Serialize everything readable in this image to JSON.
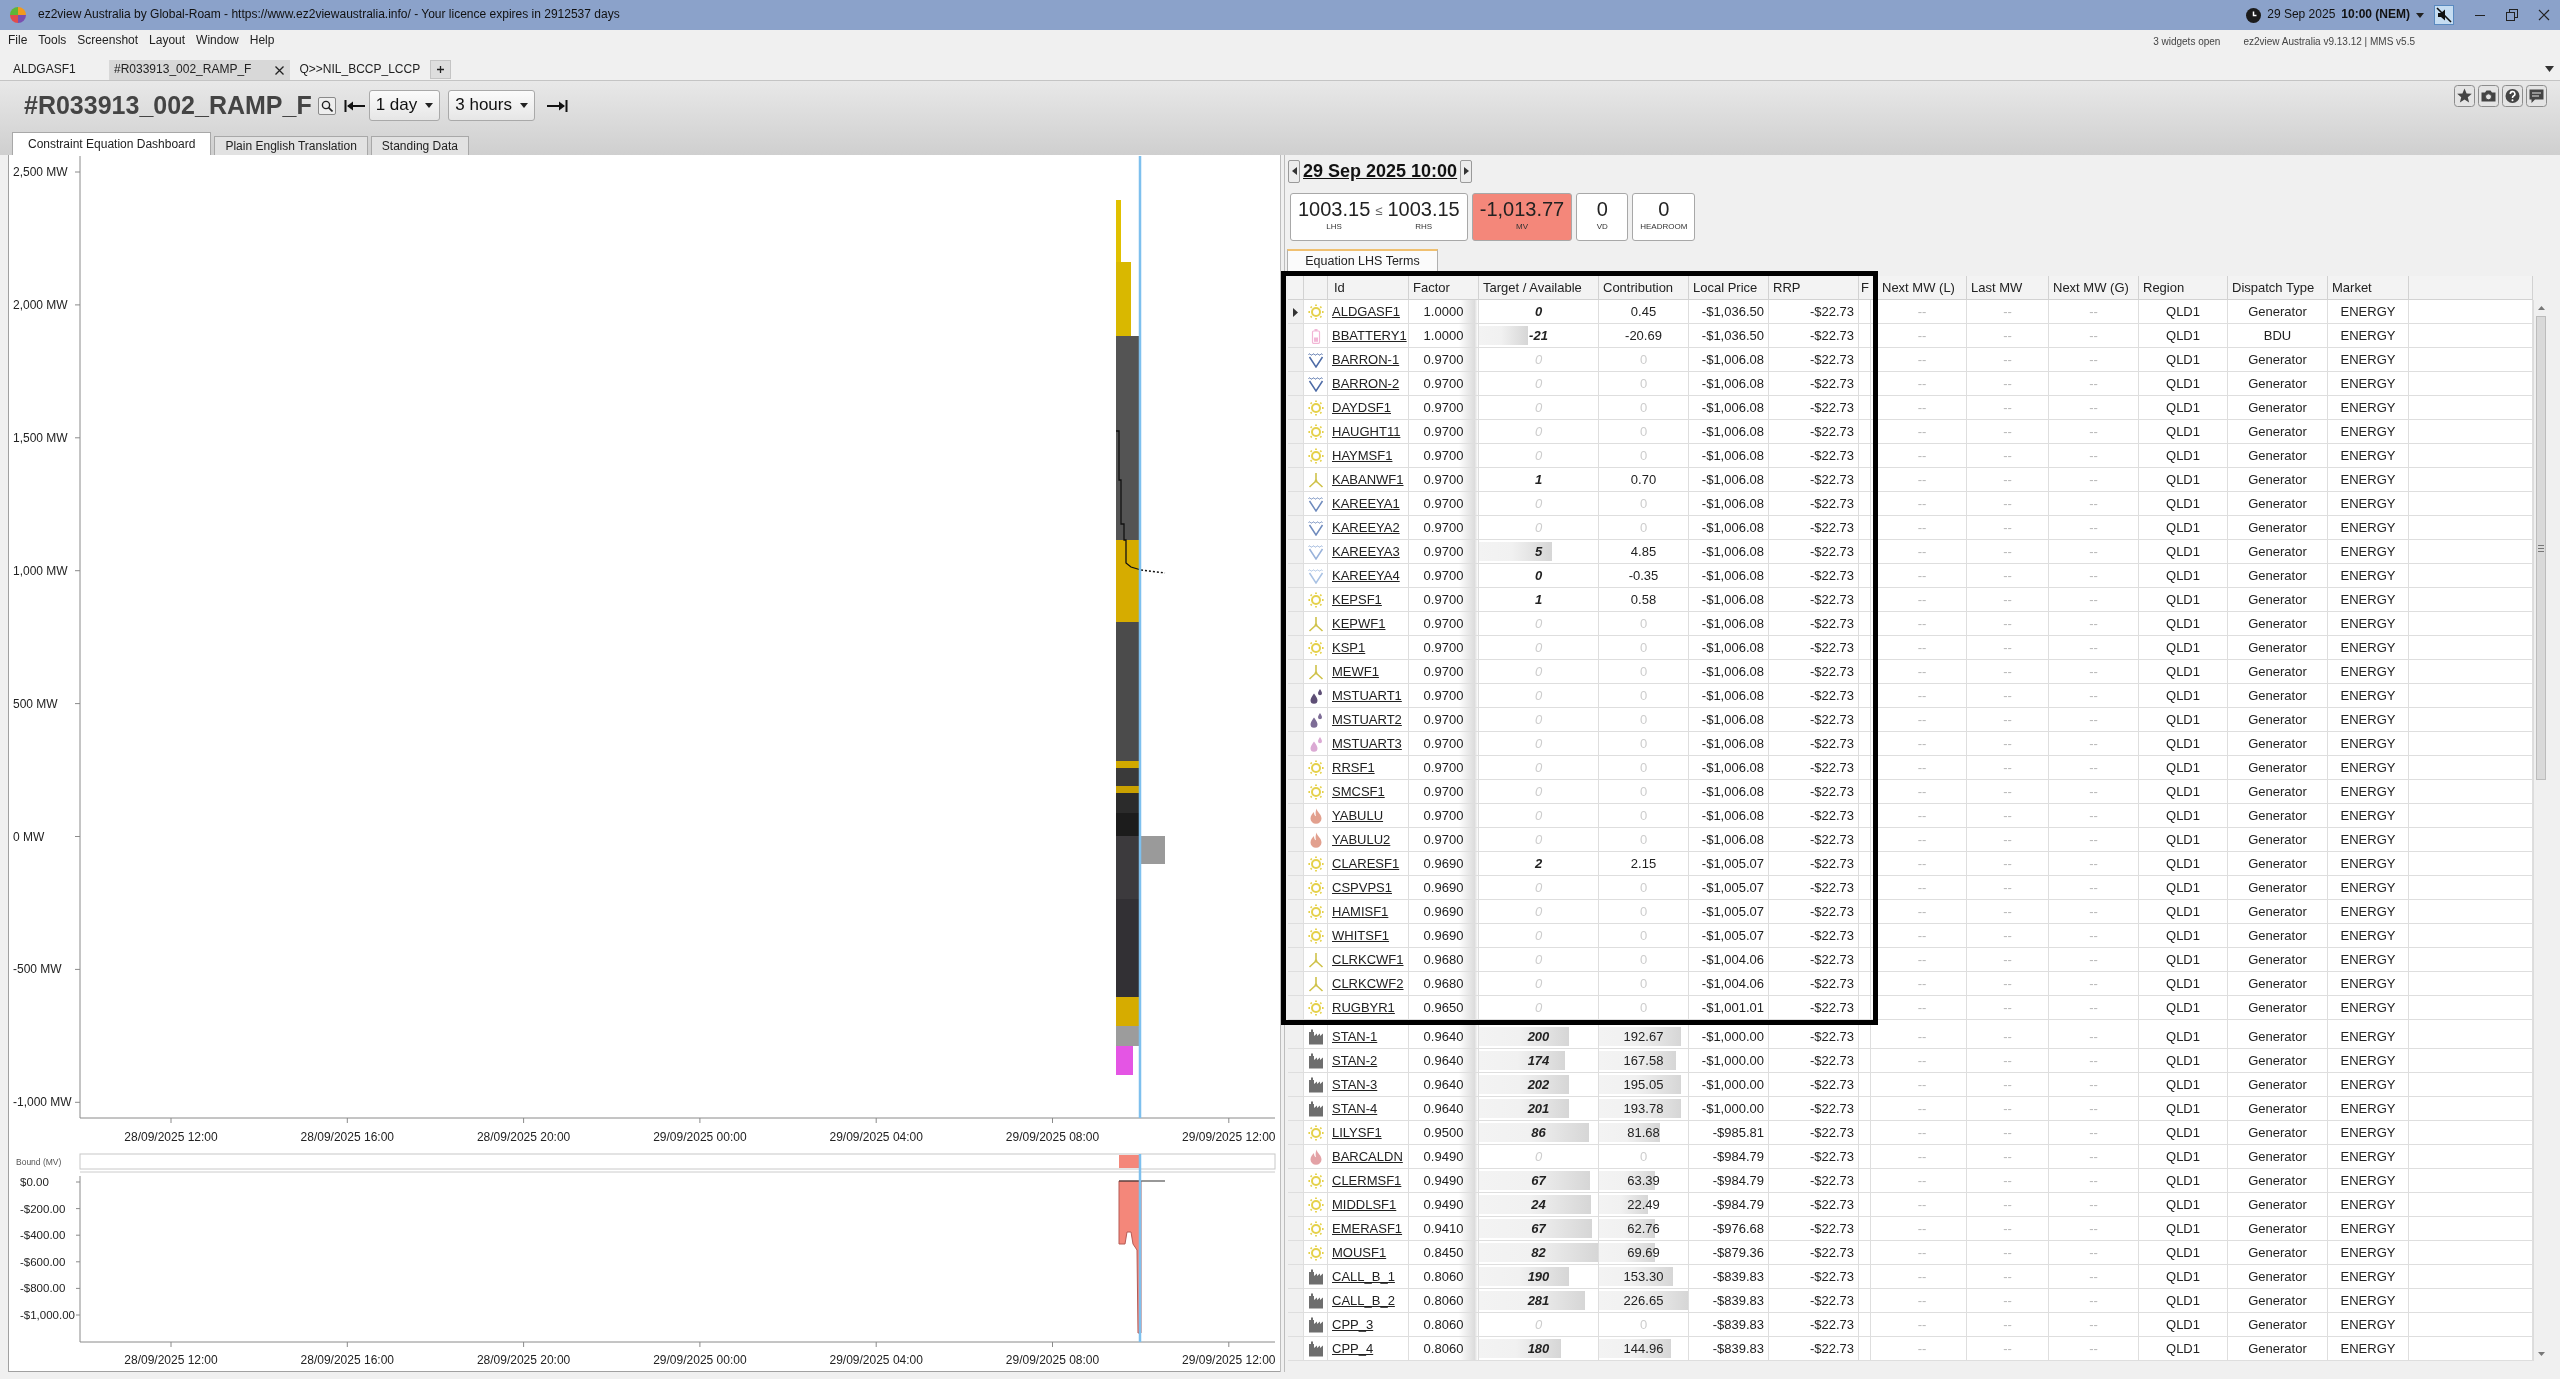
{
  "window": {
    "title": "ez2view Australia by Global-Roam - https://www.ez2viewaustralia.info/ - Your licence expires in 2912537 days",
    "date": "29 Sep 2025",
    "time": "10:00 (NEM)"
  },
  "menu": [
    "File",
    "Tools",
    "Screenshot",
    "Layout",
    "Window",
    "Help"
  ],
  "status": {
    "widgets": "3 widgets open",
    "version": "ez2view Australia v9.13.12 | MMS v5.5"
  },
  "widget_tabs": [
    {
      "label": "ALDGASF1",
      "selected": false
    },
    {
      "label": "#R033913_002_RAMP_F",
      "selected": true
    },
    {
      "label": "Q>>NIL_BCCP_LCCP",
      "selected": false
    }
  ],
  "widget": {
    "title": "#R033913_002_RAMP_F",
    "range": "1 day",
    "interval": "3 hours"
  },
  "view_tabs": [
    {
      "label": "Constraint Equation Dashboard",
      "selected": true
    },
    {
      "label": "Plain English Translation",
      "selected": false
    },
    {
      "label": "Standing Data",
      "selected": false
    }
  ],
  "chart": {
    "y_labels": [
      "2,500 MW",
      "2,000 MW",
      "1,500 MW",
      "1,000 MW",
      "500 MW",
      "0 MW",
      "-500 MW",
      "-1,000 MW"
    ],
    "x_labels": [
      "28/09/2025 12:00",
      "28/09/2025 16:00",
      "28/09/2025 20:00",
      "29/09/2025 00:00",
      "29/09/2025 04:00",
      "29/09/2025 08:00",
      "29/09/2025 12:00"
    ]
  },
  "bound_chart": {
    "label": "Bound (MV)",
    "y_labels": [
      "$0.00",
      "-$200.00",
      "-$400.00",
      "-$600.00",
      "-$800.00",
      "-$1,000.00"
    ],
    "x_labels": [
      "28/09/2025 12:00",
      "28/09/2025 16:00",
      "28/09/2025 20:00",
      "29/09/2025 00:00",
      "29/09/2025 04:00",
      "29/09/2025 08:00",
      "29/09/2025 12:00"
    ]
  },
  "interval_nav": {
    "datetime": "29 Sep 2025 10:00"
  },
  "summary": {
    "lhs": {
      "value": "1003.15",
      "caption": "LHS"
    },
    "operator": "≤",
    "rhs": {
      "value": "1003.15",
      "caption": "RHS"
    },
    "boxes": [
      {
        "value": "-1,013.77",
        "caption": "MV",
        "alert": true
      },
      {
        "value": "0",
        "caption": "VD",
        "alert": false
      },
      {
        "value": "0",
        "caption": "HEADROOM",
        "alert": false
      }
    ]
  },
  "terms_tab": {
    "label": "Equation LHS Terms",
    "selected": true
  },
  "table": {
    "columns": [
      "Id",
      "Factor",
      "Target / Available",
      "Contribution",
      "Local Price",
      "RRP",
      "F",
      "Next MW (L)",
      "Last MW",
      "Next MW (G)",
      "Region",
      "Dispatch Type",
      "Market"
    ],
    "rows": [
      {
        "selected": true,
        "kind": "sun",
        "color": "#e5d14a",
        "id": "ALDGASF1",
        "factor": "1.0000",
        "target": {
          "text": "0"
        },
        "contribution": {
          "text": "0.45"
        },
        "dimmed": false,
        "local_price": "-$1,036.50",
        "rrp": "-$22.73",
        "next_mw_l": "--",
        "last_mw": "--",
        "next_mw_g": "--",
        "region": "QLD1",
        "dispatch_type": "Generator",
        "market": "ENERGY"
      },
      {
        "selected": false,
        "kind": "battery",
        "color": "#f2b6d6",
        "id": "BBATTERY1",
        "factor": "1.0000",
        "target": {
          "text": "-21",
          "level": 0.41
        },
        "contribution": {
          "text": "-20.69"
        },
        "dimmed": false,
        "local_price": "-$1,036.50",
        "rrp": "-$22.73",
        "next_mw_l": "--",
        "last_mw": "--",
        "next_mw_g": "--",
        "region": "QLD1",
        "dispatch_type": "BDU",
        "market": "ENERGY"
      },
      {
        "selected": false,
        "kind": "water",
        "color": "#4d6ba6",
        "id": "BARRON-1",
        "factor": "0.9700",
        "target": {
          "text": "0"
        },
        "contribution": {
          "text": "0"
        },
        "dimmed": true,
        "local_price": "-$1,006.08",
        "rrp": "-$22.73",
        "next_mw_l": "--",
        "last_mw": "--",
        "next_mw_g": "--",
        "region": "QLD1",
        "dispatch_type": "Generator",
        "market": "ENERGY"
      },
      {
        "selected": false,
        "kind": "water",
        "color": "#4d6ba6",
        "id": "BARRON-2",
        "factor": "0.9700",
        "target": {
          "text": "0"
        },
        "contribution": {
          "text": "0"
        },
        "dimmed": true,
        "local_price": "-$1,006.08",
        "rrp": "-$22.73",
        "next_mw_l": "--",
        "last_mw": "--",
        "next_mw_g": "--",
        "region": "QLD1",
        "dispatch_type": "Generator",
        "market": "ENERGY"
      },
      {
        "selected": false,
        "kind": "sun",
        "color": "#e5d14a",
        "id": "DAYDSF1",
        "factor": "0.9700",
        "target": {
          "text": "0"
        },
        "contribution": {
          "text": "0"
        },
        "dimmed": true,
        "local_price": "-$1,006.08",
        "rrp": "-$22.73",
        "next_mw_l": "--",
        "last_mw": "--",
        "next_mw_g": "--",
        "region": "QLD1",
        "dispatch_type": "Generator",
        "market": "ENERGY"
      },
      {
        "selected": false,
        "kind": "sun",
        "color": "#e5d14a",
        "id": "HAUGHT11",
        "factor": "0.9700",
        "target": {
          "text": "0"
        },
        "contribution": {
          "text": "0"
        },
        "dimmed": true,
        "local_price": "-$1,006.08",
        "rrp": "-$22.73",
        "next_mw_l": "--",
        "last_mw": "--",
        "next_mw_g": "--",
        "region": "QLD1",
        "dispatch_type": "Generator",
        "market": "ENERGY"
      },
      {
        "selected": false,
        "kind": "sun",
        "color": "#e5d14a",
        "id": "HAYMSF1",
        "factor": "0.9700",
        "target": {
          "text": "0"
        },
        "contribution": {
          "text": "0"
        },
        "dimmed": true,
        "local_price": "-$1,006.08",
        "rrp": "-$22.73",
        "next_mw_l": "--",
        "last_mw": "--",
        "next_mw_g": "--",
        "region": "QLD1",
        "dispatch_type": "Generator",
        "market": "ENERGY"
      },
      {
        "selected": false,
        "kind": "turbine",
        "color": "#cfc24a",
        "id": "KABANWF1",
        "factor": "0.9700",
        "target": {
          "text": "1"
        },
        "contribution": {
          "text": "0.70"
        },
        "dimmed": false,
        "local_price": "-$1,006.08",
        "rrp": "-$22.73",
        "next_mw_l": "--",
        "last_mw": "--",
        "next_mw_g": "--",
        "region": "QLD1",
        "dispatch_type": "Generator",
        "market": "ENERGY"
      },
      {
        "selected": false,
        "kind": "water",
        "color": "#6f8bbd",
        "id": "KAREEYA1",
        "factor": "0.9700",
        "target": {
          "text": "0"
        },
        "contribution": {
          "text": "0"
        },
        "dimmed": true,
        "local_price": "-$1,006.08",
        "rrp": "-$22.73",
        "next_mw_l": "--",
        "last_mw": "--",
        "next_mw_g": "--",
        "region": "QLD1",
        "dispatch_type": "Generator",
        "market": "ENERGY"
      },
      {
        "selected": false,
        "kind": "water",
        "color": "#6f8bbd",
        "id": "KAREEYA2",
        "factor": "0.9700",
        "target": {
          "text": "0"
        },
        "contribution": {
          "text": "0"
        },
        "dimmed": true,
        "local_price": "-$1,006.08",
        "rrp": "-$22.73",
        "next_mw_l": "--",
        "last_mw": "--",
        "next_mw_g": "--",
        "region": "QLD1",
        "dispatch_type": "Generator",
        "market": "ENERGY"
      },
      {
        "selected": false,
        "kind": "water",
        "color": "#98b2da",
        "id": "KAREEYA3",
        "factor": "0.9700",
        "target": {
          "text": "5",
          "level": 0.61
        },
        "contribution": {
          "text": "4.85"
        },
        "dimmed": false,
        "local_price": "-$1,006.08",
        "rrp": "-$22.73",
        "next_mw_l": "--",
        "last_mw": "--",
        "next_mw_g": "--",
        "region": "QLD1",
        "dispatch_type": "Generator",
        "market": "ENERGY"
      },
      {
        "selected": false,
        "kind": "water",
        "color": "#a9c2e4",
        "id": "KAREEYA4",
        "factor": "0.9700",
        "target": {
          "text": "0"
        },
        "contribution": {
          "text": "-0.35"
        },
        "dimmed": false,
        "local_price": "-$1,006.08",
        "rrp": "-$22.73",
        "next_mw_l": "--",
        "last_mw": "--",
        "next_mw_g": "--",
        "region": "QLD1",
        "dispatch_type": "Generator",
        "market": "ENERGY"
      },
      {
        "selected": false,
        "kind": "sun",
        "color": "#e5d14a",
        "id": "KEPSF1",
        "factor": "0.9700",
        "target": {
          "text": "1"
        },
        "contribution": {
          "text": "0.58"
        },
        "dimmed": false,
        "local_price": "-$1,006.08",
        "rrp": "-$22.73",
        "next_mw_l": "--",
        "last_mw": "--",
        "next_mw_g": "--",
        "region": "QLD1",
        "dispatch_type": "Generator",
        "market": "ENERGY"
      },
      {
        "selected": false,
        "kind": "turbine",
        "color": "#cfc24a",
        "id": "KEPWF1",
        "factor": "0.9700",
        "target": {
          "text": "0"
        },
        "contribution": {
          "text": "0"
        },
        "dimmed": true,
        "local_price": "-$1,006.08",
        "rrp": "-$22.73",
        "next_mw_l": "--",
        "last_mw": "--",
        "next_mw_g": "--",
        "region": "QLD1",
        "dispatch_type": "Generator",
        "market": "ENERGY"
      },
      {
        "selected": false,
        "kind": "sun",
        "color": "#e5d14a",
        "id": "KSP1",
        "factor": "0.9700",
        "target": {
          "text": "0"
        },
        "contribution": {
          "text": "0"
        },
        "dimmed": true,
        "local_price": "-$1,006.08",
        "rrp": "-$22.73",
        "next_mw_l": "--",
        "last_mw": "--",
        "next_mw_g": "--",
        "region": "QLD1",
        "dispatch_type": "Generator",
        "market": "ENERGY"
      },
      {
        "selected": false,
        "kind": "turbine",
        "color": "#cfc24a",
        "id": "MEWF1",
        "factor": "0.9700",
        "target": {
          "text": "0"
        },
        "contribution": {
          "text": "0"
        },
        "dimmed": true,
        "local_price": "-$1,006.08",
        "rrp": "-$22.73",
        "next_mw_l": "--",
        "last_mw": "--",
        "next_mw_g": "--",
        "region": "QLD1",
        "dispatch_type": "Generator",
        "market": "ENERGY"
      },
      {
        "selected": false,
        "kind": "drops",
        "color": "#5e4f76",
        "id": "MSTUART1",
        "factor": "0.9700",
        "target": {
          "text": "0"
        },
        "contribution": {
          "text": "0"
        },
        "dimmed": true,
        "local_price": "-$1,006.08",
        "rrp": "-$22.73",
        "next_mw_l": "--",
        "last_mw": "--",
        "next_mw_g": "--",
        "region": "QLD1",
        "dispatch_type": "Generator",
        "market": "ENERGY"
      },
      {
        "selected": false,
        "kind": "drops",
        "color": "#7d6c96",
        "id": "MSTUART2",
        "factor": "0.9700",
        "target": {
          "text": "0"
        },
        "contribution": {
          "text": "0"
        },
        "dimmed": true,
        "local_price": "-$1,006.08",
        "rrp": "-$22.73",
        "next_mw_l": "--",
        "last_mw": "--",
        "next_mw_g": "--",
        "region": "QLD1",
        "dispatch_type": "Generator",
        "market": "ENERGY"
      },
      {
        "selected": false,
        "kind": "drops",
        "color": "#dbaad4",
        "id": "MSTUART3",
        "factor": "0.9700",
        "target": {
          "text": "0"
        },
        "contribution": {
          "text": "0"
        },
        "dimmed": true,
        "local_price": "-$1,006.08",
        "rrp": "-$22.73",
        "next_mw_l": "--",
        "last_mw": "--",
        "next_mw_g": "--",
        "region": "QLD1",
        "dispatch_type": "Generator",
        "market": "ENERGY"
      },
      {
        "selected": false,
        "kind": "sun",
        "color": "#e5d14a",
        "id": "RRSF1",
        "factor": "0.9700",
        "target": {
          "text": "0"
        },
        "contribution": {
          "text": "0"
        },
        "dimmed": true,
        "local_price": "-$1,006.08",
        "rrp": "-$22.73",
        "next_mw_l": "--",
        "last_mw": "--",
        "next_mw_g": "--",
        "region": "QLD1",
        "dispatch_type": "Generator",
        "market": "ENERGY"
      },
      {
        "selected": false,
        "kind": "sun",
        "color": "#e5d14a",
        "id": "SMCSF1",
        "factor": "0.9700",
        "target": {
          "text": "0"
        },
        "contribution": {
          "text": "0"
        },
        "dimmed": true,
        "local_price": "-$1,006.08",
        "rrp": "-$22.73",
        "next_mw_l": "--",
        "last_mw": "--",
        "next_mw_g": "--",
        "region": "QLD1",
        "dispatch_type": "Generator",
        "market": "ENERGY"
      },
      {
        "selected": false,
        "kind": "flame",
        "color": "#e2a08e",
        "id": "YABULU",
        "factor": "0.9700",
        "target": {
          "text": "0"
        },
        "contribution": {
          "text": "0"
        },
        "dimmed": true,
        "local_price": "-$1,006.08",
        "rrp": "-$22.73",
        "next_mw_l": "--",
        "last_mw": "--",
        "next_mw_g": "--",
        "region": "QLD1",
        "dispatch_type": "Generator",
        "market": "ENERGY"
      },
      {
        "selected": false,
        "kind": "flame",
        "color": "#e2a08e",
        "id": "YABULU2",
        "factor": "0.9700",
        "target": {
          "text": "0"
        },
        "contribution": {
          "text": "0"
        },
        "dimmed": true,
        "local_price": "-$1,006.08",
        "rrp": "-$22.73",
        "next_mw_l": "--",
        "last_mw": "--",
        "next_mw_g": "--",
        "region": "QLD1",
        "dispatch_type": "Generator",
        "market": "ENERGY"
      },
      {
        "selected": false,
        "kind": "sun",
        "color": "#e5d14a",
        "id": "CLARESF1",
        "factor": "0.9690",
        "target": {
          "text": "2"
        },
        "contribution": {
          "text": "2.15"
        },
        "dimmed": false,
        "local_price": "-$1,005.07",
        "rrp": "-$22.73",
        "next_mw_l": "--",
        "last_mw": "--",
        "next_mw_g": "--",
        "region": "QLD1",
        "dispatch_type": "Generator",
        "market": "ENERGY"
      },
      {
        "selected": false,
        "kind": "sun",
        "color": "#e5d14a",
        "id": "CSPVPS1",
        "factor": "0.9690",
        "target": {
          "text": "0"
        },
        "contribution": {
          "text": "0"
        },
        "dimmed": true,
        "local_price": "-$1,005.07",
        "rrp": "-$22.73",
        "next_mw_l": "--",
        "last_mw": "--",
        "next_mw_g": "--",
        "region": "QLD1",
        "dispatch_type": "Generator",
        "market": "ENERGY"
      },
      {
        "selected": false,
        "kind": "sun",
        "color": "#e5d14a",
        "id": "HAMISF1",
        "factor": "0.9690",
        "target": {
          "text": "0"
        },
        "contribution": {
          "text": "0"
        },
        "dimmed": true,
        "local_price": "-$1,005.07",
        "rrp": "-$22.73",
        "next_mw_l": "--",
        "last_mw": "--",
        "next_mw_g": "--",
        "region": "QLD1",
        "dispatch_type": "Generator",
        "market": "ENERGY"
      },
      {
        "selected": false,
        "kind": "sun",
        "color": "#e5d14a",
        "id": "WHITSF1",
        "factor": "0.9690",
        "target": {
          "text": "0"
        },
        "contribution": {
          "text": "0"
        },
        "dimmed": true,
        "local_price": "-$1,005.07",
        "rrp": "-$22.73",
        "next_mw_l": "--",
        "last_mw": "--",
        "next_mw_g": "--",
        "region": "QLD1",
        "dispatch_type": "Generator",
        "market": "ENERGY"
      },
      {
        "selected": false,
        "kind": "turbine",
        "color": "#cfc24a",
        "id": "CLRKCWF1",
        "factor": "0.9680",
        "target": {
          "text": "0"
        },
        "contribution": {
          "text": "0"
        },
        "dimmed": true,
        "local_price": "-$1,004.06",
        "rrp": "-$22.73",
        "next_mw_l": "--",
        "last_mw": "--",
        "next_mw_g": "--",
        "region": "QLD1",
        "dispatch_type": "Generator",
        "market": "ENERGY"
      },
      {
        "selected": false,
        "kind": "turbine",
        "color": "#cfc24a",
        "id": "CLRKCWF2",
        "factor": "0.9680",
        "target": {
          "text": "0"
        },
        "contribution": {
          "text": "0"
        },
        "dimmed": true,
        "local_price": "-$1,004.06",
        "rrp": "-$22.73",
        "next_mw_l": "--",
        "last_mw": "--",
        "next_mw_g": "--",
        "region": "QLD1",
        "dispatch_type": "Generator",
        "market": "ENERGY"
      },
      {
        "selected": false,
        "kind": "sun",
        "color": "#e5d14a",
        "id": "RUGBYR1",
        "factor": "0.9650",
        "target": {
          "text": "0"
        },
        "contribution": {
          "text": "0"
        },
        "dimmed": true,
        "local_price": "-$1,001.01",
        "rrp": "-$22.73",
        "next_mw_l": "--",
        "last_mw": "--",
        "next_mw_g": "--",
        "region": "QLD1",
        "dispatch_type": "Generator",
        "market": "ENERGY"
      },
      {
        "selected": false,
        "kind": "factory",
        "color": "#6e6e6e",
        "id": "STAN-1",
        "factor": "0.9640",
        "target": {
          "text": "200",
          "level": 0.755
        },
        "contribution": {
          "text": "192.67",
          "level": 0.92
        },
        "dimmed": false,
        "local_price": "-$1,000.00",
        "rrp": "-$22.73",
        "next_mw_l": "--",
        "last_mw": "--",
        "next_mw_g": "--",
        "region": "QLD1",
        "dispatch_type": "Generator",
        "market": "ENERGY"
      },
      {
        "selected": false,
        "kind": "factory",
        "color": "#6e6e6e",
        "id": "STAN-2",
        "factor": "0.9640",
        "target": {
          "text": "174",
          "level": 0.72
        },
        "contribution": {
          "text": "167.58",
          "level": 0.86
        },
        "dimmed": false,
        "local_price": "-$1,000.00",
        "rrp": "-$22.73",
        "next_mw_l": "--",
        "last_mw": "--",
        "next_mw_g": "--",
        "region": "QLD1",
        "dispatch_type": "Generator",
        "market": "ENERGY"
      },
      {
        "selected": false,
        "kind": "factory",
        "color": "#6e6e6e",
        "id": "STAN-3",
        "factor": "0.9640",
        "target": {
          "text": "202",
          "level": 0.755
        },
        "contribution": {
          "text": "195.05",
          "level": 0.92
        },
        "dimmed": false,
        "local_price": "-$1,000.00",
        "rrp": "-$22.73",
        "next_mw_l": "--",
        "last_mw": "--",
        "next_mw_g": "--",
        "region": "QLD1",
        "dispatch_type": "Generator",
        "market": "ENERGY"
      },
      {
        "selected": false,
        "kind": "factory",
        "color": "#6e6e6e",
        "id": "STAN-4",
        "factor": "0.9640",
        "target": {
          "text": "201",
          "level": 0.755
        },
        "contribution": {
          "text": "193.78",
          "level": 0.92
        },
        "dimmed": false,
        "local_price": "-$1,000.00",
        "rrp": "-$22.73",
        "next_mw_l": "--",
        "last_mw": "--",
        "next_mw_g": "--",
        "region": "QLD1",
        "dispatch_type": "Generator",
        "market": "ENERGY"
      },
      {
        "selected": false,
        "kind": "sun",
        "color": "#e5d14a",
        "id": "LILYSF1",
        "factor": "0.9500",
        "target": {
          "text": "86",
          "level": 0.925
        },
        "contribution": {
          "text": "81.68",
          "level": 0.68
        },
        "dimmed": false,
        "local_price": "-$985.81",
        "rrp": "-$22.73",
        "next_mw_l": "--",
        "last_mw": "--",
        "next_mw_g": "--",
        "region": "QLD1",
        "dispatch_type": "Generator",
        "market": "ENERGY"
      },
      {
        "selected": false,
        "kind": "flame",
        "color": "#e3a2a6",
        "id": "BARCALDN",
        "factor": "0.9490",
        "target": {
          "text": "0"
        },
        "contribution": {
          "text": "0"
        },
        "dimmed": true,
        "local_price": "-$984.79",
        "rrp": "-$22.73",
        "next_mw_l": "--",
        "last_mw": "--",
        "next_mw_g": "--",
        "region": "QLD1",
        "dispatch_type": "Generator",
        "market": "ENERGY"
      },
      {
        "selected": false,
        "kind": "sun",
        "color": "#e5d14a",
        "id": "CLERMSF1",
        "factor": "0.9490",
        "target": {
          "text": "67",
          "level": 0.935
        },
        "contribution": {
          "text": "63.39",
          "level": 0.63
        },
        "dimmed": false,
        "local_price": "-$984.79",
        "rrp": "-$22.73",
        "next_mw_l": "--",
        "last_mw": "--",
        "next_mw_g": "--",
        "region": "QLD1",
        "dispatch_type": "Generator",
        "market": "ENERGY"
      },
      {
        "selected": false,
        "kind": "sun",
        "color": "#e5d14a",
        "id": "MIDDLSF1",
        "factor": "0.9490",
        "target": {
          "text": "24",
          "level": 0.945
        },
        "contribution": {
          "text": "22.49",
          "level": 0.55
        },
        "dimmed": false,
        "local_price": "-$984.79",
        "rrp": "-$22.73",
        "next_mw_l": "--",
        "last_mw": "--",
        "next_mw_g": "--",
        "region": "QLD1",
        "dispatch_type": "Generator",
        "market": "ENERGY"
      },
      {
        "selected": false,
        "kind": "sun",
        "color": "#e5d14a",
        "id": "EMERASF1",
        "factor": "0.9410",
        "target": {
          "text": "67",
          "level": 0.95
        },
        "contribution": {
          "text": "62.76",
          "level": 0.63
        },
        "dimmed": false,
        "local_price": "-$976.68",
        "rrp": "-$22.73",
        "next_mw_l": "--",
        "last_mw": "--",
        "next_mw_g": "--",
        "region": "QLD1",
        "dispatch_type": "Generator",
        "market": "ENERGY"
      },
      {
        "selected": false,
        "kind": "sun",
        "color": "#e5d14a",
        "id": "MOUSF1",
        "factor": "0.8450",
        "target": {
          "text": "82",
          "level": 1
        },
        "contribution": {
          "text": "69.69",
          "level": 0.63
        },
        "dimmed": false,
        "local_price": "-$879.36",
        "rrp": "-$22.73",
        "next_mw_l": "--",
        "last_mw": "--",
        "next_mw_g": "--",
        "region": "QLD1",
        "dispatch_type": "Generator",
        "market": "ENERGY"
      },
      {
        "selected": false,
        "kind": "factory",
        "color": "#6e6e6e",
        "id": "CALL_B_1",
        "factor": "0.8060",
        "target": {
          "text": "190",
          "level": 0.76
        },
        "contribution": {
          "text": "153.30",
          "level": 0.83
        },
        "dimmed": false,
        "local_price": "-$839.83",
        "rrp": "-$22.73",
        "next_mw_l": "--",
        "last_mw": "--",
        "next_mw_g": "--",
        "region": "QLD1",
        "dispatch_type": "Generator",
        "market": "ENERGY"
      },
      {
        "selected": false,
        "kind": "factory",
        "color": "#6e6e6e",
        "id": "CALL_B_2",
        "factor": "0.8060",
        "target": {
          "text": "281",
          "level": 0.89
        },
        "contribution": {
          "text": "226.65",
          "level": 1
        },
        "dimmed": false,
        "local_price": "-$839.83",
        "rrp": "-$22.73",
        "next_mw_l": "--",
        "last_mw": "--",
        "next_mw_g": "--",
        "region": "QLD1",
        "dispatch_type": "Generator",
        "market": "ENERGY"
      },
      {
        "selected": false,
        "kind": "factory",
        "color": "#6e6e6e",
        "id": "CPP_3",
        "factor": "0.8060",
        "target": {
          "text": "0"
        },
        "contribution": {
          "text": "0"
        },
        "dimmed": true,
        "local_price": "-$839.83",
        "rrp": "-$22.73",
        "next_mw_l": "--",
        "last_mw": "--",
        "next_mw_g": "--",
        "region": "QLD1",
        "dispatch_type": "Generator",
        "market": "ENERGY"
      },
      {
        "selected": false,
        "kind": "factory",
        "color": "#6e6e6e",
        "id": "CPP_4",
        "factor": "0.8060",
        "target": {
          "text": "180",
          "level": 0.69
        },
        "contribution": {
          "text": "144.96",
          "level": 0.81
        },
        "dimmed": false,
        "local_price": "-$839.83",
        "rrp": "-$22.73",
        "next_mw_l": "--",
        "last_mw": "--",
        "next_mw_g": "--",
        "region": "QLD1",
        "dispatch_type": "Generator",
        "market": "ENERGY"
      }
    ]
  }
}
